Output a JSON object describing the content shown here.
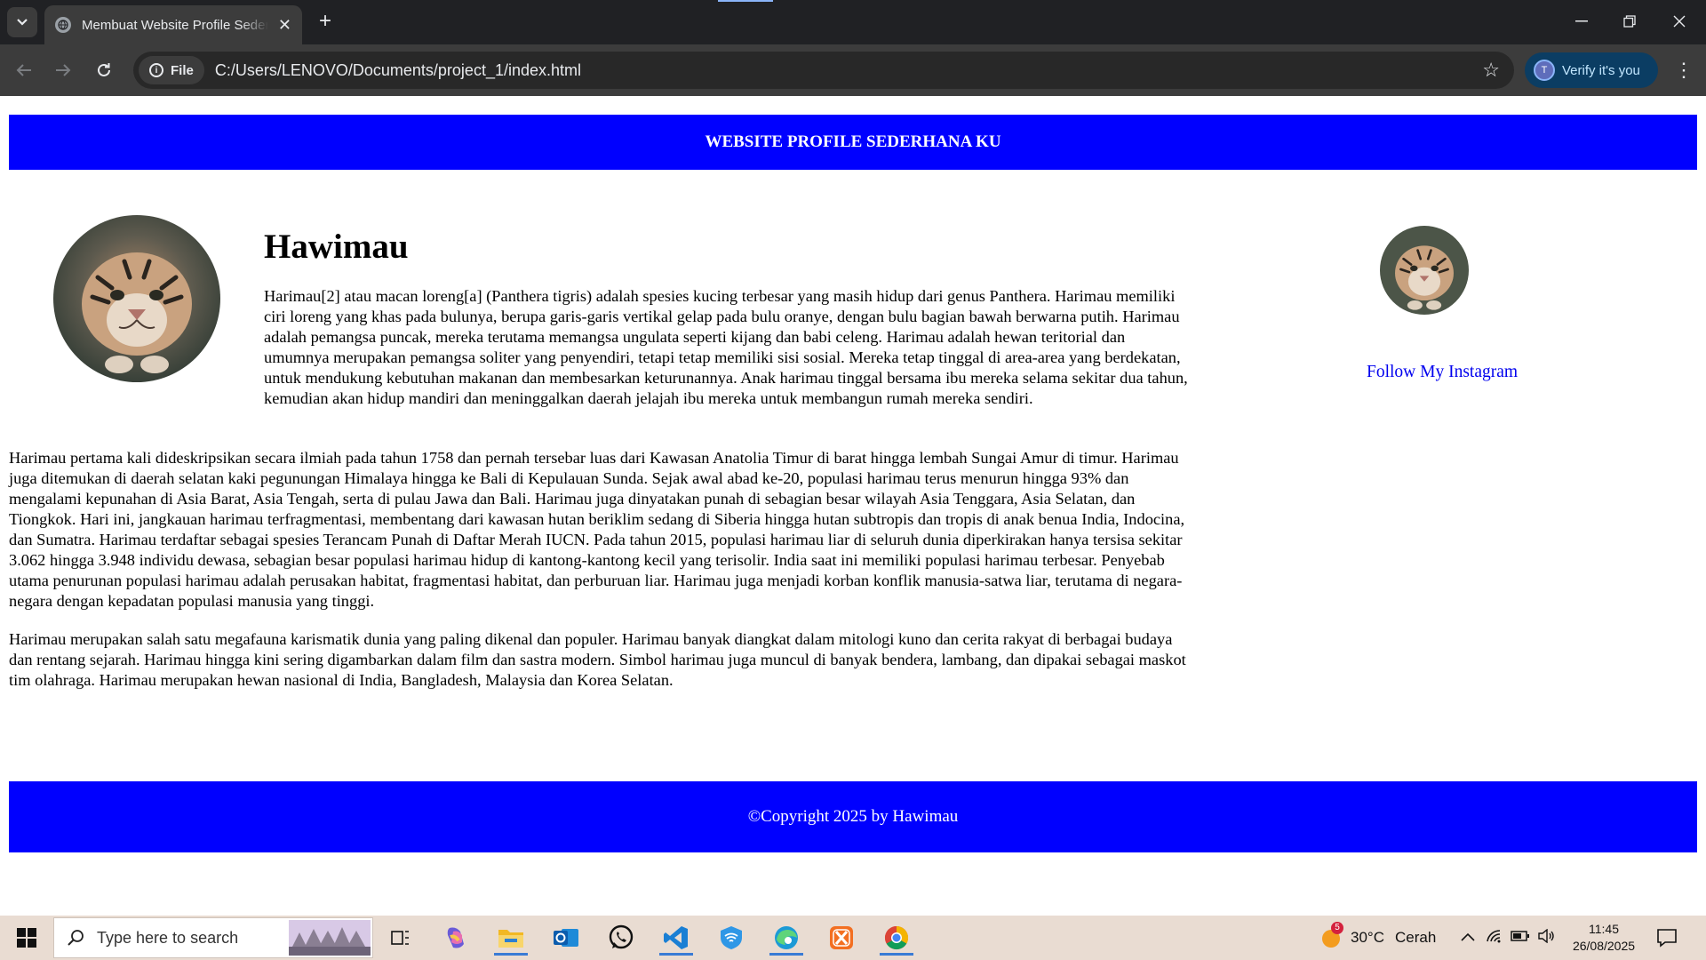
{
  "browser": {
    "tab_title": "Membuat Website Profile Sederhana",
    "address_chip": "File",
    "url": "C:/Users/LENOVO/Documents/project_1/index.html",
    "verify_label": "Verify it's you",
    "verify_initial": "T"
  },
  "page": {
    "header_title": "WEBSITE PROFILE SEDERHANA KU",
    "article_title": "Hawimau",
    "paragraphs": [
      "Harimau[2] atau macan loreng[a] (Panthera tigris) adalah spesies kucing terbesar yang masih hidup dari genus Panthera. Harimau memiliki ciri loreng yang khas pada bulunya, berupa garis-garis vertikal gelap pada bulu oranye, dengan bulu bagian bawah berwarna putih. Harimau adalah pemangsa puncak, mereka terutama memangsa ungulata seperti kijang dan babi celeng. Harimau adalah hewan teritorial dan umumnya merupakan pemangsa soliter yang penyendiri, tetapi tetap memiliki sisi sosial. Mereka tetap tinggal di area-area yang berdekatan, untuk mendukung kebutuhan makanan dan membesarkan keturunannya. Anak harimau tinggal bersama ibu mereka selama sekitar dua tahun, kemudian akan hidup mandiri dan meninggalkan daerah jelajah ibu mereka untuk membangun rumah mereka sendiri.",
      "Harimau pertama kali dideskripsikan secara ilmiah pada tahun 1758 dan pernah tersebar luas dari Kawasan Anatolia Timur di barat hingga lembah Sungai Amur di timur. Harimau juga ditemukan di daerah selatan kaki pegunungan Himalaya hingga ke Bali di Kepulauan Sunda. Sejak awal abad ke-20, populasi harimau terus menurun hingga 93% dan mengalami kepunahan di Asia Barat, Asia Tengah, serta di pulau Jawa dan Bali. Harimau juga dinyatakan punah di sebagian besar wilayah Asia Tenggara, Asia Selatan, dan Tiongkok. Hari ini, jangkauan harimau terfragmentasi, membentang dari kawasan hutan beriklim sedang di Siberia hingga hutan subtropis dan tropis di anak benua India, Indocina, dan Sumatra. Harimau terdaftar sebagai spesies Terancam Punah di Daftar Merah IUCN. Pada tahun 2015, populasi harimau liar di seluruh dunia diperkirakan hanya tersisa sekitar 3.062 hingga 3.948 individu dewasa, sebagian besar populasi harimau hidup di kantong-kantong kecil yang terisolir. India saat ini memiliki populasi harimau terbesar. Penyebab utama penurunan populasi harimau adalah perusakan habitat, fragmentasi habitat, dan perburuan liar. Harimau juga menjadi korban konflik manusia-satwa liar, terutama di negara-negara dengan kepadatan populasi manusia yang tinggi.",
      "Harimau merupakan salah satu megafauna karismatik dunia yang paling dikenal dan populer. Harimau banyak diangkat dalam mitologi kuno dan cerita rakyat di berbagai budaya dan rentang sejarah. Harimau hingga kini sering digambarkan dalam film dan sastra modern. Simbol harimau juga muncul di banyak bendera, lambang, dan dipakai sebagai maskot tim olahraga. Harimau merupakan hewan nasional di India, Bangladesh, Malaysia dan Korea Selatan."
    ],
    "instagram_link": "Follow My Instagram",
    "footer_text": "©Copyright 2025 by Hawimau",
    "accent_color": "#0000ff"
  },
  "taskbar": {
    "search_placeholder": "Type here to search",
    "weather_temp": "30°C",
    "weather_desc": "Cerah",
    "weather_badge": "5",
    "time": "11:45",
    "date": "26/08/2025"
  }
}
